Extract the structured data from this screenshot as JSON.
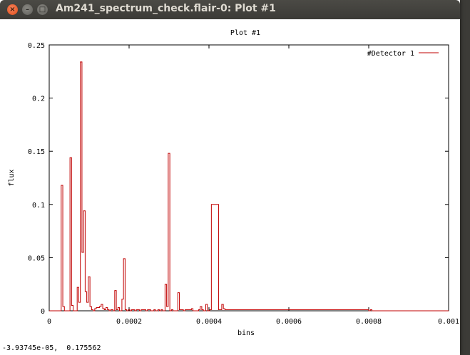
{
  "window": {
    "title": "Am241_spectrum_check.flair-0: Plot #1",
    "close_glyph": "×",
    "minimize_glyph": "–",
    "maximize_glyph": "□"
  },
  "status": {
    "coordinates": "-3.93745e-05,  0.175562"
  },
  "colors": {
    "series": "#c00000",
    "titlebar": "#3c3b37",
    "close_button": "#df4a16"
  },
  "chart_data": {
    "type": "line",
    "step": true,
    "title": "Plot #1",
    "xlabel": "bins",
    "ylabel": "flux",
    "xlim": [
      0,
      0.001
    ],
    "ylim": [
      0,
      0.25
    ],
    "x_tick_labels": [
      "0",
      "0.0002",
      "0.0004",
      "0.0006",
      "0.0008",
      "0.001"
    ],
    "x_ticks": [
      0,
      0.0002,
      0.0004,
      0.0006,
      0.0008,
      0.001
    ],
    "y_tick_labels": [
      "0",
      "0.05",
      "0.1",
      "0.15",
      "0.2",
      "0.25"
    ],
    "y_ticks": [
      0,
      0.05,
      0.1,
      0.15,
      0.2,
      0.25
    ],
    "grid": false,
    "legend_position": "top-right",
    "series": [
      {
        "name": "#Detector 1",
        "x": [
          0,
          3e-05,
          3.4e-05,
          3.8e-05,
          5.2e-05,
          5.6e-05,
          6e-05,
          7e-05,
          7.4e-05,
          7.8e-05,
          8.2e-05,
          8.6e-05,
          9e-05,
          9.4e-05,
          9.8e-05,
          0.000102,
          0.000106,
          0.00011,
          0.000114,
          0.000118,
          0.000122,
          0.000126,
          0.00013,
          0.000134,
          0.000138,
          0.000142,
          0.000146,
          0.00015,
          0.000154,
          0.00016,
          0.000164,
          0.000168,
          0.000172,
          0.000176,
          0.000182,
          0.000186,
          0.00019,
          0.000194,
          0.000198,
          0.000202,
          0.000206,
          0.000214,
          0.000218,
          0.000226,
          0.00023,
          0.000242,
          0.000246,
          0.00025,
          0.000254,
          0.000262,
          0.000266,
          0.000272,
          0.000276,
          0.00028,
          0.000284,
          0.00029,
          0.000294,
          0.000298,
          0.000302,
          0.000306,
          0.00031,
          0.000322,
          0.000326,
          0.000336,
          0.00034,
          0.000356,
          0.00036,
          0.000374,
          0.000378,
          0.000382,
          0.000386,
          0.000392,
          0.000396,
          0.000402,
          0.000406,
          0.000424,
          0.000428,
          0.000432,
          0.000436,
          0.00044,
          0.000444,
          0.000448,
          0.000452,
          0.000456,
          0.00046,
          0.000464,
          0.000468,
          0.0008,
          0.000804,
          0.000808,
          0.001
        ],
        "values": [
          0,
          0.118,
          0.004,
          0,
          0.144,
          0.005,
          0,
          0.022,
          0.008,
          0.234,
          0.055,
          0.094,
          0.018,
          0.008,
          0.032,
          0.004,
          0.001,
          0,
          0.002,
          0.003,
          0.003,
          0.004,
          0.006,
          0.002,
          0.001,
          0.003,
          0.001,
          0,
          0.001,
          0,
          0.019,
          0.001,
          0.003,
          0,
          0.011,
          0.049,
          0.001,
          0,
          0.001,
          0,
          0.001,
          0,
          0.001,
          0,
          0.001,
          0,
          0.001,
          0.001,
          0,
          0.001,
          0,
          0.001,
          0,
          0.001,
          0,
          0.025,
          0.004,
          0.148,
          0,
          0.001,
          0,
          0.017,
          0.001,
          0,
          0.001,
          0.002,
          0,
          0.001,
          0.004,
          0.001,
          0,
          0.006,
          0,
          0.001,
          0.1,
          0.001,
          0.001,
          0.006,
          0.002,
          0.001,
          0.001,
          0.001,
          0.001,
          0.001,
          0.001,
          0.001,
          0.001,
          0,
          0.001,
          0,
          0
        ]
      }
    ]
  }
}
